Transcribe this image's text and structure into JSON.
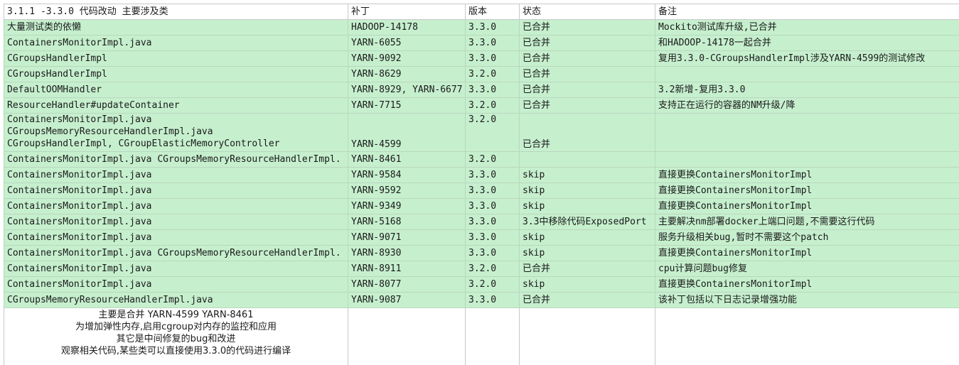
{
  "columns": [
    "3.1.1 -3.3.0 代码改动 主要涉及类",
    "补丁",
    "版本",
    "状态",
    "备注"
  ],
  "rows": [
    {
      "cls": "大量测试类的依懒",
      "patch": "HADOOP-14178",
      "ver": "3.3.0",
      "status": "已合并",
      "note": "Mockito测试库升级,已合并"
    },
    {
      "cls": "ContainersMonitorImpl.java",
      "patch": "YARN-6055",
      "ver": "3.3.0",
      "status": "已合并",
      "note": "和HADOOP-14178一起合并"
    },
    {
      "cls": "CGroupsHandlerImpl",
      "patch": "YARN-9092",
      "ver": "3.3.0",
      "status": "已合并",
      "note": "复用3.3.0-CGroupsHandlerImpl涉及YARN-4599的测试修改"
    },
    {
      "cls": "CGroupsHandlerImpl",
      "patch": "YARN-8629",
      "ver": "3.2.0",
      "status": "已合并",
      "note": ""
    },
    {
      "cls": "DefaultOOMHandler",
      "patch": "YARN-8929, YARN-6677",
      "ver": "3.3.0",
      "status": "已合并",
      "note": "3.2新增-复用3.3.0"
    },
    {
      "cls": "ResourceHandler#updateContainer",
      "patch": "YARN-7715",
      "ver": "3.2.0",
      "status": "已合并",
      "note": "支持正在运行的容器的NM升级/降"
    }
  ],
  "tall_row": {
    "cls_lines": [
      "ContainersMonitorImpl.java",
      "CGroupsMemoryResourceHandlerImpl.java",
      "CGroupsHandlerImpl, CGroupElasticMemoryController"
    ],
    "patch": "YARN-4599",
    "ver": "3.2.0",
    "status": "已合并",
    "note": ""
  },
  "rows2": [
    {
      "cls": "ContainersMonitorImpl.java CGroupsMemoryResourceHandlerImpl.",
      "patch": "YARN-8461",
      "ver": "3.2.0",
      "status": "",
      "note": ""
    },
    {
      "cls": "ContainersMonitorImpl.java",
      "patch": "YARN-9584",
      "ver": "3.3.0",
      "status": "skip",
      "note": "直接更换ContainersMonitorImpl"
    },
    {
      "cls": "ContainersMonitorImpl.java",
      "patch": "YARN-9592",
      "ver": "3.3.0",
      "status": "skip",
      "note": "直接更换ContainersMonitorImpl"
    },
    {
      "cls": "ContainersMonitorImpl.java",
      "patch": "YARN-9349",
      "ver": "3.3.0",
      "status": "skip",
      "note": "直接更换ContainersMonitorImpl"
    },
    {
      "cls": "ContainersMonitorImpl.java",
      "patch": "YARN-5168",
      "ver": "3.3.0",
      "status": "3.3中移除代码ExposedPort",
      "note": "主要解决nm部署docker上端口问题,不需要这行代码"
    },
    {
      "cls": "ContainersMonitorImpl.java",
      "patch": "YARN-9071",
      "ver": "3.3.0",
      "status": "skip",
      "note": "服务升级相关bug,暂时不需要这个patch"
    },
    {
      "cls": "ContainersMonitorImpl.java CGroupsMemoryResourceHandlerImpl.",
      "patch": "YARN-8930",
      "ver": "3.3.0",
      "status": "skip",
      "note": "直接更换ContainersMonitorImpl"
    },
    {
      "cls": "ContainersMonitorImpl.java",
      "patch": "YARN-8911",
      "ver": "3.2.0",
      "status": "已合并",
      "note": "cpu计算问题bug修复"
    },
    {
      "cls": "ContainersMonitorImpl.java",
      "patch": "YARN-8077",
      "ver": "3.2.0",
      "status": "skip",
      "note": "直接更换ContainersMonitorImpl"
    },
    {
      "cls": "CGroupsMemoryResourceHandlerImpl.java",
      "patch": "YARN-9087",
      "ver": "3.3.0",
      "status": "已合并",
      "note": "该补丁包括以下日志记录增强功能"
    }
  ],
  "note_lines": [
    "主要是合并 YARN-4599 YARN-8461",
    "为增加弹性内存,启用cgroup对内存的监控和应用",
    "其它是中间修复的bug和改进",
    "观察相关代码,某些类可以直接使用3.3.0的代码进行编译"
  ]
}
